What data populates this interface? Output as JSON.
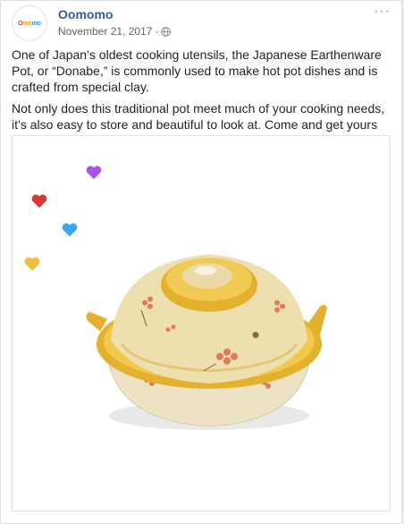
{
  "post": {
    "page_name": "Oomomo",
    "avatar_text": [
      "O",
      "mo",
      "mo"
    ],
    "date": "November 21, 2017",
    "separator": "·",
    "more_label": "···",
    "paragraphs": [
      "One of Japan’s oldest cooking utensils, the Japanese Earthenware Pot, or “Donabe,” is commonly used to make hot pot dishes and is crafted from special clay.",
      "Not only does this traditional pot meet much of your cooking needs, it’s also easy to store and beautiful to look at. Come and get yours today!"
    ]
  },
  "reactions": {
    "hearts": [
      {
        "name": "purple",
        "color": "#a855e6"
      },
      {
        "name": "red",
        "color": "#d8363a"
      },
      {
        "name": "blue",
        "color": "#3ba7f0"
      },
      {
        "name": "yellow",
        "color": "#f2bd3a"
      }
    ]
  },
  "colors": {
    "link_blue": "#385898",
    "pot_glaze": "#e3b12e",
    "pot_body": "#ede3c4",
    "flower": "#e07a5f"
  },
  "icons": {
    "privacy": "globe-icon",
    "options": "more-options-icon",
    "emoji": "pot-emoji-icon",
    "product": "donabe-pot-image"
  }
}
